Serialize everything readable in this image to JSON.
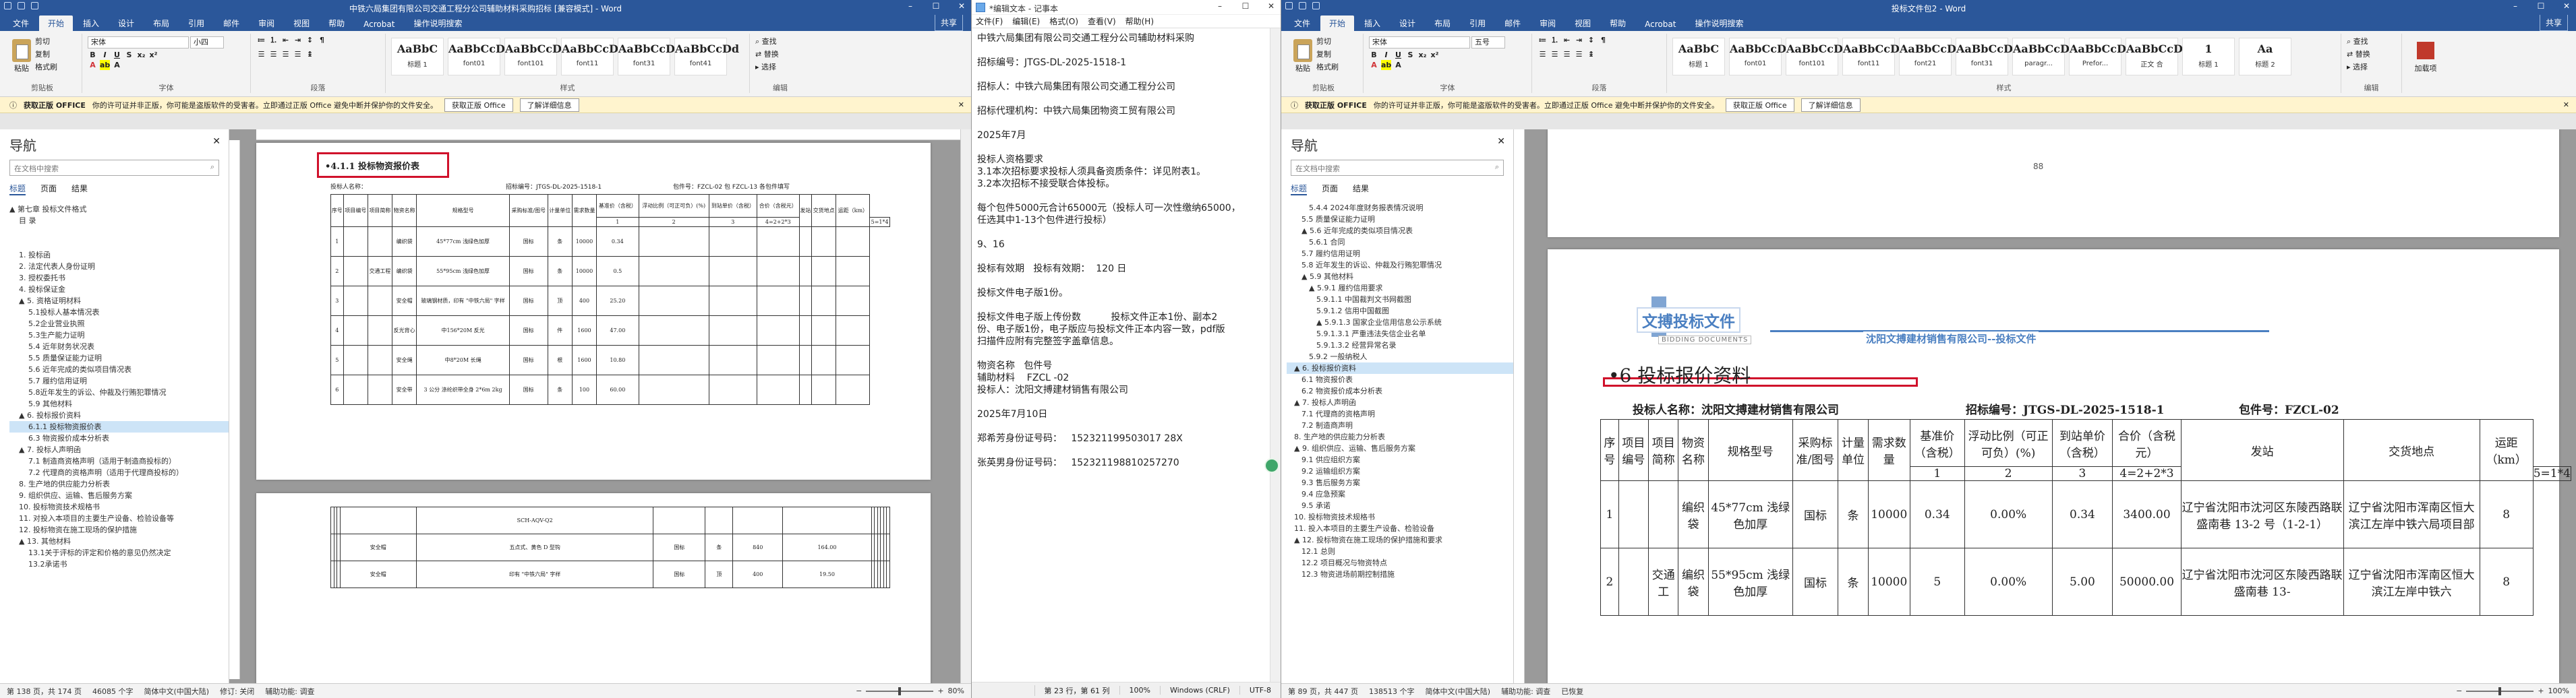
{
  "left_word": {
    "title": "中铁六局集团有限公司交通工程分公司辅助材料采购招标 [兼容模式] - Word",
    "tabs": [
      "文件",
      "开始",
      "插入",
      "设计",
      "布局",
      "引用",
      "邮件",
      "审阅",
      "视图",
      "帮助",
      "Acrobat",
      "操作说明搜索"
    ],
    "share": "共享",
    "clipboard": {
      "paste": "粘贴",
      "cut": "剪切",
      "copy": "复制",
      "painter": "格式刷",
      "label": "剪贴板"
    },
    "font": {
      "name": "宋体",
      "size": "小四",
      "label": "字体"
    },
    "paragraph_label": "段落",
    "styles": [
      {
        "sample": "AaBbC",
        "name": "标题 1"
      },
      {
        "sample": "AaBbCcDd",
        "name": "font01"
      },
      {
        "sample": "AaBbCcDd",
        "name": "font101"
      },
      {
        "sample": "AaBbCcDd",
        "name": "font11"
      },
      {
        "sample": "AaBbCcDd",
        "name": "font31"
      },
      {
        "sample": "AaBbCcDd",
        "name": "font41"
      }
    ],
    "styles_label": "样式",
    "editing": [
      "查找",
      "替换",
      "选择"
    ],
    "editing_label": "编辑",
    "message": {
      "bold": "获取正版 OFFICE",
      "text": "你的许可证并非正版，你可能是盗版软件的受害者。立即通过正版 Office 避免中断并保护你的文件安全。",
      "btn1": "获取正版 Office",
      "btn2": "了解详细信息"
    },
    "nav": {
      "title": "导航",
      "search": "在文档中搜索",
      "tabs": [
        "标题",
        "页面",
        "结果"
      ],
      "items": [
        {
          "t": "▲ 第七章 投标文件格式",
          "lvl": 0
        },
        {
          "t": "目 录",
          "lvl": 1
        },
        {
          "t": "",
          "lvl": 1
        },
        {
          "t": "",
          "lvl": 1
        },
        {
          "t": "1. 投标函",
          "lvl": 1
        },
        {
          "t": "2. 法定代表人身份证明",
          "lvl": 1
        },
        {
          "t": "3. 授权委托书",
          "lvl": 1
        },
        {
          "t": "4. 投标保证金",
          "lvl": 1
        },
        {
          "t": "▲ 5. 资格证明材料",
          "lvl": 1
        },
        {
          "t": "5.1投标人基本情况表",
          "lvl": 2
        },
        {
          "t": "5.2企业营业执照",
          "lvl": 2
        },
        {
          "t": "5.3生产能力证明",
          "lvl": 2
        },
        {
          "t": "5.4 近年财务状况表",
          "lvl": 2
        },
        {
          "t": "5.5 质量保证能力证明",
          "lvl": 2
        },
        {
          "t": "5.6 近年完成的类似项目情况表",
          "lvl": 2
        },
        {
          "t": "5.7 履约信用证明",
          "lvl": 2
        },
        {
          "t": "5.8近年发生的诉讼、仲裁及行贿犯罪情况",
          "lvl": 2
        },
        {
          "t": "5.9 其他材料",
          "lvl": 2
        },
        {
          "t": "▲ 6. 投标报价资料",
          "lvl": 1
        },
        {
          "t": "6.1.1 投标物资报价表",
          "lvl": 2,
          "sel": true
        },
        {
          "t": "6.3 物资报价成本分析表",
          "lvl": 2
        },
        {
          "t": "▲ 7. 投标人声明函",
          "lvl": 1
        },
        {
          "t": "7.1 制造商资格声明（适用于制造商投标的）",
          "lvl": 2
        },
        {
          "t": "7.2 代理商的资格声明（适用于代理商投标的）",
          "lvl": 2
        },
        {
          "t": "8. 生产地的供应能力分析表",
          "lvl": 1
        },
        {
          "t": "9. 组织供应、运输、售后服务方案",
          "lvl": 1
        },
        {
          "t": "10. 投标物资技术规格书",
          "lvl": 1
        },
        {
          "t": "11. 对投入本项目的主要生产设备、检验设备等",
          "lvl": 1
        },
        {
          "t": "12. 投标物资在施工现场的保护措施",
          "lvl": 1
        },
        {
          "t": "▲ 13. 其他材料",
          "lvl": 1
        },
        {
          "t": "13.1关于评标的评定和价格的意见仍然决定",
          "lvl": 2
        },
        {
          "t": "13.2承诺书",
          "lvl": 2
        }
      ]
    },
    "doc": {
      "heading": "•4.1.1 投标物资报价表",
      "bidder": "投标人名称：",
      "code": "招标编号：JTGS-DL-2025-1518-1",
      "pkg": "包件号：FZCL-02 包 FZCL-13 各包件填写",
      "headers": [
        "序号",
        "项目编号",
        "项目简称",
        "物资名称",
        "规格型号",
        "采购标准/图号",
        "计量单位",
        "需求数量",
        "基准价（含税）",
        "浮动比例（可正可负）(%)",
        "到站单价（含税）",
        "合价（含税元）",
        "发站",
        "交货地点",
        "运距（km）"
      ],
      "subheaders": [
        "1",
        "2",
        "3",
        "4=2+2*3",
        "5=1*4"
      ],
      "rows": [
        [
          "1",
          "编织袋",
          "45*77cm 浅绿色加厚",
          "国标",
          "条",
          "10000",
          "0.34"
        ],
        [
          "2",
          "编织袋",
          "55*95cm 浅绿色加厚",
          "国标",
          "条",
          "10000",
          "0.5"
        ],
        [
          "3",
          "安全帽",
          "玻璃钢材质，印有 \"中铁六局\" 字样",
          "国标",
          "顶",
          "400",
          "25.20"
        ],
        [
          "4",
          "反光背心",
          "中156*20M 反光",
          "国标",
          "件",
          "1600",
          "47.00"
        ],
        [
          "5",
          "安全绳",
          "中8*20M 长绳",
          "国标",
          "根",
          "1600",
          "10.80"
        ],
        [
          "6",
          "安全带",
          "3 公分 涤纶织带全身 2*6m 2kg",
          "国标",
          "条",
          "100",
          "60.00"
        ]
      ],
      "proj_name": "交通工程",
      "row2_rows": [
        [
          "",
          "安全帽",
          "五点式、黄色 D 型钩",
          "国标",
          "条",
          "840",
          "164.00"
        ],
        [
          "",
          "安全帽",
          "印有 \"中铁六局\" 字样",
          "国标",
          "顶",
          "400",
          "19.50"
        ]
      ],
      "row2_top": "SCH-AQV-Q2",
      "ruler_marks": [
        "2",
        "4",
        "6",
        "8",
        "10",
        "12",
        "14",
        "16",
        "18",
        "20",
        "22",
        "24",
        "26",
        "28",
        "30",
        "32",
        "34",
        "36",
        "38",
        "40",
        "42",
        "44",
        "46",
        "48",
        "50",
        "52",
        "54",
        "56",
        "58",
        "60",
        "62",
        "64",
        "66",
        "68",
        "70",
        "72",
        "74"
      ]
    },
    "status": {
      "page": "第 138 页，共 174 页",
      "words": "46085 个字",
      "lang": "简体中文(中国大陆)",
      "track": "修订: 关闭",
      "access": "辅助功能: 调查",
      "zoom": "80%"
    }
  },
  "notepad": {
    "title": "*编辑文本 - 记事本",
    "menu": [
      "文件(F)",
      "编辑(E)",
      "格式(O)",
      "查看(V)",
      "帮助(H)"
    ],
    "lines": [
      "中铁六局集团有限公司交通工程分公司辅助材料采购",
      "",
      "招标编号：JTGS-DL-2025-1518-1",
      "",
      "招标人：中铁六局集团有限公司交通工程分公司",
      "",
      "招标代理机构：中铁六局集团物资工贸有限公司",
      "",
      "2025年7月",
      "",
      "投标人资格要求",
      "3.1本次招标要求投标人须具备资质条件：详见附表1。",
      "3.2本次招标不接受联合体投标。",
      "",
      "每个包件5000元合计65000元（投标人可一次性缴纳65000，",
      "任选其中1-13个包件进行投标）",
      "",
      "9、16",
      "",
      "投标有效期   投标有效期：  120 日",
      "",
      "投标文件电子版1份。",
      "",
      "投标文件电子版上传份数          投标文件正本1份、副本2",
      "份、电子版1份，电子版应与投标文件正本内容一致，pdf版",
      "扫描件应附有完整签字盖章信息。",
      "",
      "物资名称   包件号",
      "辅助材料    FZCL -02",
      "投标人：沈阳文搏建材销售有限公司",
      "",
      "2025年7月10日",
      "",
      "郑希芳身份证号码：   152321199503017 28X",
      "",
      "张英男身份证号码：   152321198810257270"
    ],
    "status": {
      "pos": "第 23 行，第 61 列",
      "zoom": "100%",
      "eol": "Windows (CRLF)",
      "enc": "UTF-8"
    }
  },
  "right_word": {
    "title": "投标文件包2 - Word",
    "tabs": [
      "文件",
      "开始",
      "插入",
      "设计",
      "布局",
      "引用",
      "邮件",
      "审阅",
      "视图",
      "帮助",
      "Acrobat",
      "操作说明搜索"
    ],
    "share": "共享",
    "clipboard": {
      "paste": "粘贴",
      "cut": "剪切",
      "copy": "复制",
      "painter": "格式刷",
      "label": "剪贴板"
    },
    "font": {
      "name": "宋体",
      "size": "五号",
      "label": "字体"
    },
    "paragraph_label": "段落",
    "styles": [
      {
        "sample": "AaBbC",
        "name": "标题 1"
      },
      {
        "sample": "AaBbCcDd",
        "name": "font01"
      },
      {
        "sample": "AaBbCcDd",
        "name": "font101"
      },
      {
        "sample": "AaBbCcDd",
        "name": "font11"
      },
      {
        "sample": "AaBbCcDd",
        "name": "font21"
      },
      {
        "sample": "AaBbCcDd",
        "name": "font31"
      },
      {
        "sample": "AaBbCcDd",
        "name": "paragr..."
      },
      {
        "sample": "AaBbCcDd",
        "name": "Prefor..."
      },
      {
        "sample": "AaBbCcD",
        "name": "正文 合"
      },
      {
        "sample": "1",
        "name": "标题 1"
      },
      {
        "sample": "Aa",
        "name": "标题 2"
      }
    ],
    "styles_label": "样式",
    "editing": [
      "查找",
      "替换",
      "选择"
    ],
    "editing_label": "编辑",
    "addin": "加载项",
    "message": {
      "bold": "获取正版 OFFICE",
      "text": "你的许可证并非正版，你可能是盗版软件的受害者。立即通过正版 Office 避免中断并保护你的文件安全。",
      "btn1": "获取正版 Office",
      "btn2": "了解详细信息"
    },
    "nav": {
      "title": "导航",
      "search": "在文档中搜索",
      "tabs": [
        "标题",
        "页面",
        "结果"
      ],
      "items": [
        {
          "t": "5.4.4 2024年度财务报表情况说明",
          "lvl": 3
        },
        {
          "t": "5.5 质量保证能力证明",
          "lvl": 2
        },
        {
          "t": "▲ 5.6 近年完成的类似项目情况表",
          "lvl": 2
        },
        {
          "t": "5.6.1 合同",
          "lvl": 3
        },
        {
          "t": "5.7 履约信用证明",
          "lvl": 2
        },
        {
          "t": "5.8 近年发生的诉讼、仲裁及行贿犯罪情况",
          "lvl": 2
        },
        {
          "t": "▲ 5.9 其他材料",
          "lvl": 2
        },
        {
          "t": "▲ 5.9.1 履约信用要求",
          "lvl": 3
        },
        {
          "t": "5.9.1.1 中国裁判文书网截图",
          "lvl": 4
        },
        {
          "t": "5.9.1.2 信用中国截图",
          "lvl": 4
        },
        {
          "t": "▲ 5.9.1.3 国家企业信用信息公示系统",
          "lvl": 4
        },
        {
          "t": "5.9.1.3.1 严重违法失信企业名单",
          "lvl": 4
        },
        {
          "t": "5.9.1.3.2 经营异常名录",
          "lvl": 4
        },
        {
          "t": "5.9.2 一般纳税人",
          "lvl": 3
        },
        {
          "t": "▲ 6. 投标报价资料",
          "lvl": 1,
          "sel": true
        },
        {
          "t": "6.1 物资报价表",
          "lvl": 2
        },
        {
          "t": "6.2 物资报价成本分析表",
          "lvl": 2
        },
        {
          "t": "▲ 7. 投标人声明函",
          "lvl": 1
        },
        {
          "t": "7.1 代理商的资格声明",
          "lvl": 2
        },
        {
          "t": "7.2 制造商声明",
          "lvl": 2
        },
        {
          "t": "8. 生产地的供应能力分析表",
          "lvl": 1
        },
        {
          "t": "▲ 9. 组织供应、运输、售后服务方案",
          "lvl": 1
        },
        {
          "t": "9.1 供应组织方案",
          "lvl": 2
        },
        {
          "t": "9.2 运输组织方案",
          "lvl": 2
        },
        {
          "t": "9.3 售后服务方案",
          "lvl": 2
        },
        {
          "t": "9.4 应急预案",
          "lvl": 2
        },
        {
          "t": "9.5 承诺",
          "lvl": 2
        },
        {
          "t": "10. 投标物资技术规格书",
          "lvl": 1
        },
        {
          "t": "11. 投入本项目的主要生产设备、检验设备",
          "lvl": 1
        },
        {
          "t": "▲ 12. 投标物资在施工现场的保护措施和要求",
          "lvl": 1
        },
        {
          "t": "12.1 总则",
          "lvl": 2
        },
        {
          "t": "12.2 项目概况与物资特点",
          "lvl": 2
        },
        {
          "t": "12.3 物资进场前期控制措施",
          "lvl": 2
        }
      ]
    },
    "doc": {
      "page_no": "88",
      "banner_title": "文搏投标文件",
      "banner_sub": "BIDDING DOCUMENTS",
      "banner_company": "沈阳文搏建材销售有限公司--投标文件",
      "heading": "•6  投标报价资料",
      "bidder": "投标人名称：沈阳文搏建材销售有限公司",
      "code": "招标编号：JTGS-DL-2025-1518-1",
      "pkg": "包件号：FZCL-02",
      "headers": [
        "序号",
        "项目编号",
        "项目简称",
        "物资名称",
        "规格型号",
        "采购标准/图号",
        "计量单位",
        "需求数量",
        "基准价（含税）",
        "浮动比例（可正可负）(%)",
        "到站单价（含税）",
        "合价（含税元）",
        "发站",
        "交货地点",
        "运距（km）"
      ],
      "subheaders": [
        "1",
        "2",
        "3",
        "4=2+2*3",
        "5=1*4"
      ],
      "rows": [
        [
          "1",
          "编织袋",
          "45*77cm 浅绿色加厚",
          "国标",
          "条",
          "10000",
          "0.34",
          "0.00%",
          "0.34",
          "3400.00",
          "辽宁省沈阳市沈河区东陵西路联盛南巷 13-2 号（1-2-1）",
          "辽宁省沈阳市浑南区恒大滨江左岸中铁六局项目部",
          "8"
        ],
        [
          "2",
          "编织袋",
          "55*95cm 浅绿色加厚",
          "国标",
          "条",
          "10000",
          "5",
          "0.00%",
          "5.00",
          "50000.00",
          "辽宁省沈阳市沈河区东陵西路联盛南巷 13-",
          "辽宁省沈阳市浑南区恒大滨江左岸中铁六",
          "8"
        ]
      ],
      "proj_name": "交通工"
    },
    "status": {
      "page": "第 89 页，共 447 页",
      "words": "138513 个字",
      "lang": "简体中文(中国大陆)",
      "access": "辅助功能: 调查",
      "focus": "已恢复",
      "zoom": "100%"
    }
  },
  "colors": {
    "word_blue": "#2b579a",
    "highlight_red": "#d0112b",
    "banner_blue": "#4a7fc1",
    "msg_yellow": "#fff4ce"
  }
}
